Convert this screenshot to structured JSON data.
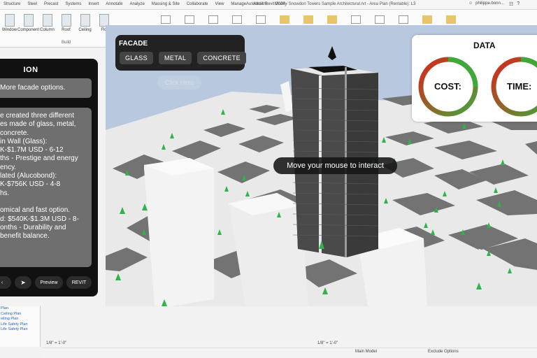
{
  "titlebar": {
    "menu": [
      "Structure",
      "Steel",
      "Precast",
      "Systems",
      "Insert",
      "Annotate",
      "Analyze",
      "Massing & Site",
      "Collaborate",
      "View",
      "Manage",
      "Add-Ins",
      "Modify"
    ],
    "app_title": "Autodesk Revit 2024 - Snowdon Towers Sample Architectural.rvt - Area Plan (Rentable): L3",
    "user": "philippe.bonn..."
  },
  "ribbon": {
    "tools": [
      "Window",
      "Component",
      "Column",
      "Roof",
      "Ceiling",
      "Flo"
    ],
    "panel_label": "Build"
  },
  "left_panel": {
    "title": "ION",
    "options_label": "More facade options.",
    "description_lines": [
      "e created three different",
      "es made of glass, metal,",
      "concrete.",
      "in Wall (Glass):",
      "K-$1.7M USD - 6-12",
      "ths - Prestige and energy",
      "ency.",
      "lated (Alucobond):",
      "K-$756K USD - 4-8",
      "hs.",
      "",
      "omical and fast option.",
      "d: $540K-$1.3M USD - 8-",
      "onths - Durability and",
      "benefit balance."
    ],
    "buttons": {
      "left": "‹",
      "send": "➤",
      "preview": "Preview",
      "revit": "REVIT"
    }
  },
  "facade": {
    "title": "FACADE",
    "options": [
      "GLASS",
      "METAL",
      "CONCRETE"
    ],
    "click_here": "Click Here"
  },
  "data_panel": {
    "title": "DATA",
    "cost_label": "COST:",
    "time_label": "TIME:",
    "colors": {
      "red": "#d7261e",
      "green": "#3fa83a"
    }
  },
  "viewport": {
    "tooltip": "Move your mouse to interact",
    "colors": {
      "sky": "#b8c8de",
      "ground": "#6f6f6f",
      "road": "#e9e9e9",
      "tower": "#3a3a3a",
      "tree": "#2fb34a"
    }
  },
  "browser": {
    "items": [
      "Plan",
      "Ceiling Plan",
      "eiling Plan",
      "Life Safety Plan",
      "Life Safety Plan"
    ]
  },
  "statusbar": {
    "scale_left": "1/8\" = 1'-0\"",
    "scale_right": "1/8\" = 1'-0\"",
    "model": "Main Model",
    "exclude": "Exclude Options"
  }
}
